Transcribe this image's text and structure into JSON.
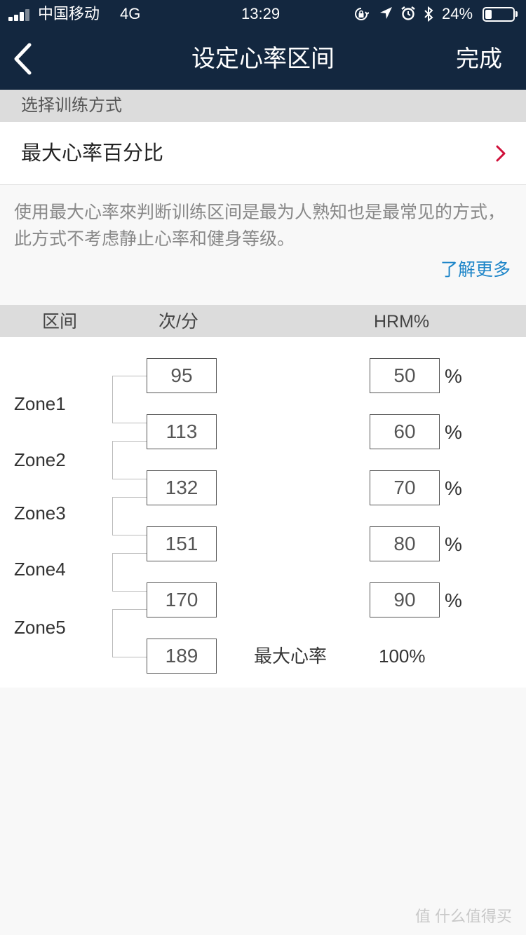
{
  "status_bar": {
    "carrier": "中国移动",
    "network": "4G",
    "time": "13:29",
    "battery": "24%",
    "battery_level": 0.24,
    "icons": [
      "orientation-lock-icon",
      "location-arrow-icon",
      "alarm-icon",
      "bluetooth-icon"
    ]
  },
  "nav": {
    "title": "设定心率区间",
    "done_label": "完成"
  },
  "method_section": {
    "header": "选择训练方式",
    "selected": "最大心率百分比"
  },
  "description": {
    "text": "使用最大心率來判断训练区间是最为人熟知也是最常见的方式，此方式不考虑静止心率和健身等级。",
    "link": "了解更多"
  },
  "table_header": {
    "zone": "区间",
    "bpm": "次/分",
    "hrm": "HRM%"
  },
  "zones": {
    "labels": [
      "Zone1",
      "Zone2",
      "Zone3",
      "Zone4",
      "Zone5"
    ],
    "bpm_values": [
      "95",
      "113",
      "132",
      "151",
      "170",
      "189"
    ],
    "hrm_values": [
      "50",
      "60",
      "70",
      "80",
      "90"
    ],
    "pct_sign": "%",
    "max_label": "最大心率",
    "max_pct": "100%"
  },
  "watermark": "值 什么值得买",
  "colors": {
    "nav_bg": "#13273f",
    "link": "#1f86c9",
    "chevron": "#d0103a",
    "section_bg": "#dcdcdc"
  }
}
